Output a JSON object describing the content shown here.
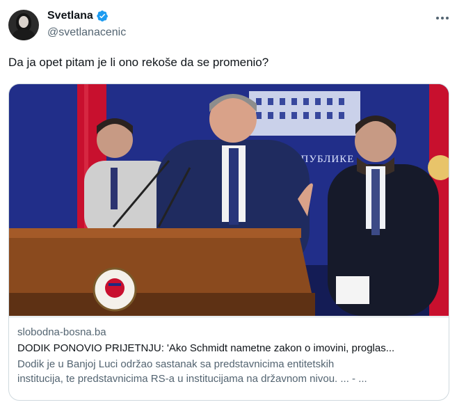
{
  "author": {
    "display_name": "Svetlana",
    "handle": "@svetlanacenic",
    "verified": true,
    "avatar_icon": "profile-photo"
  },
  "tweet": {
    "text": "Da ja opet pitam je li ono rekoše da se promenio?"
  },
  "card": {
    "domain": "slobodna-bosna.ba",
    "title": "DODIK PONOVIO PRIJETNJU: 'Ako Schmidt nametne zakon o imovini, proglas...",
    "description_line1": "Dodik je u Banjoj Luci održao sastanak sa predstavnicima entitetskih",
    "description_line2": "institucija, te predstavnicima RS-a u institucijama na državnom nivou. ... - ...",
    "image_sign_text": "РЕПУБЛИКЕ"
  },
  "colors": {
    "verified_blue": "#1d9bf0",
    "secondary_text": "#536471",
    "primary_text": "#0f1419",
    "border": "#cfd9de",
    "backdrop_blue": "#1d2a80",
    "flag_red": "#c8102e",
    "podium_brown": "#8a4a1e"
  }
}
